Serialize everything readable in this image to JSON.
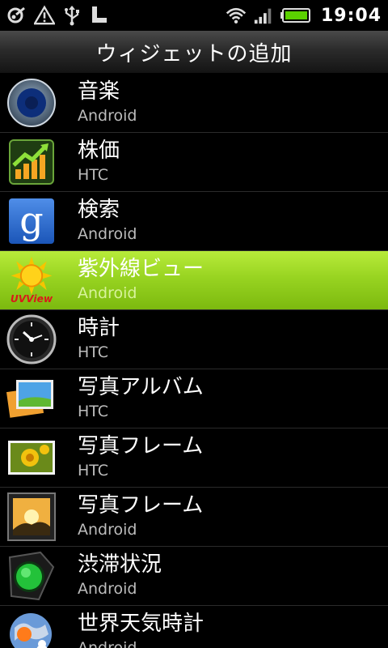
{
  "status_bar": {
    "time": "19:04",
    "left_icons": [
      "link-debug-icon",
      "warning-icon",
      "usb-icon",
      "sd-card-icon"
    ],
    "right_icons": [
      "wifi-icon",
      "signal-icon",
      "battery-icon"
    ]
  },
  "header": {
    "title": "ウィジェットの追加"
  },
  "widgets": [
    {
      "name": "音楽",
      "vendor": "Android",
      "icon": "speaker-icon",
      "selected": false
    },
    {
      "name": "株価",
      "vendor": "HTC",
      "icon": "stocks-chart-icon",
      "selected": false
    },
    {
      "name": "検索",
      "vendor": "Android",
      "icon": "google-search-icon",
      "selected": false
    },
    {
      "name": "紫外線ビュー",
      "vendor": "Android",
      "icon": "uv-sun-icon",
      "selected": true,
      "icon_label": "UVView"
    },
    {
      "name": "時計",
      "vendor": "HTC",
      "icon": "clock-icon",
      "selected": false
    },
    {
      "name": "写真アルバム",
      "vendor": "HTC",
      "icon": "photo-album-icon",
      "selected": false
    },
    {
      "name": "写真フレーム",
      "vendor": "HTC",
      "icon": "photo-frame-flower-icon",
      "selected": false
    },
    {
      "name": "写真フレーム",
      "vendor": "Android",
      "icon": "photo-frame-landscape-icon",
      "selected": false
    },
    {
      "name": "渋滞状況",
      "vendor": "Android",
      "icon": "traffic-light-icon",
      "selected": false
    },
    {
      "name": "世界天気時計",
      "vendor": "Android",
      "icon": "world-weather-icon",
      "selected": false
    }
  ],
  "colors": {
    "selected_row": "#98d421",
    "background": "#000000",
    "secondary_text": "#bcbcbc"
  }
}
